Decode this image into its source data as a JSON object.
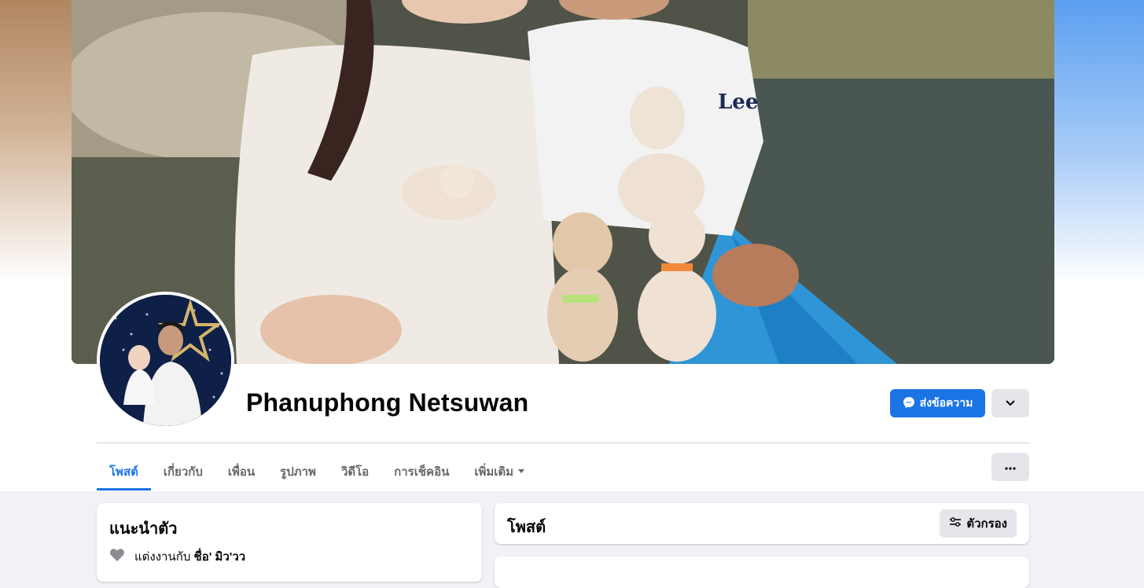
{
  "profile": {
    "name": "Phanuphong Netsuwan"
  },
  "actions": {
    "message_label": "ส่งข้อความ"
  },
  "tabs": [
    {
      "label": "โพสต์"
    },
    {
      "label": "เกี่ยวกับ"
    },
    {
      "label": "เพื่อน"
    },
    {
      "label": "รูปภาพ"
    },
    {
      "label": "วิดีโอ"
    },
    {
      "label": "การเช็คอิน"
    },
    {
      "label": "เพิ่มเติม"
    }
  ],
  "intro": {
    "title": "แนะนำตัว",
    "relationship_prefix": "แต่งงานกับ",
    "relationship_name": "ชื่อ' มิว'วว"
  },
  "posts": {
    "title": "โพสต์",
    "filter_label": "ตัวกรอง"
  },
  "icons": {
    "message": "messenger-icon",
    "dropdown": "chevron-down-icon",
    "more": "more-dots-icon",
    "filter": "filter-sliders-icon",
    "relationship": "heart-icon"
  },
  "colors": {
    "accent": "#1b74e4",
    "secondary_button": "#e4e6eb",
    "page_background": "#f0f2f5"
  }
}
